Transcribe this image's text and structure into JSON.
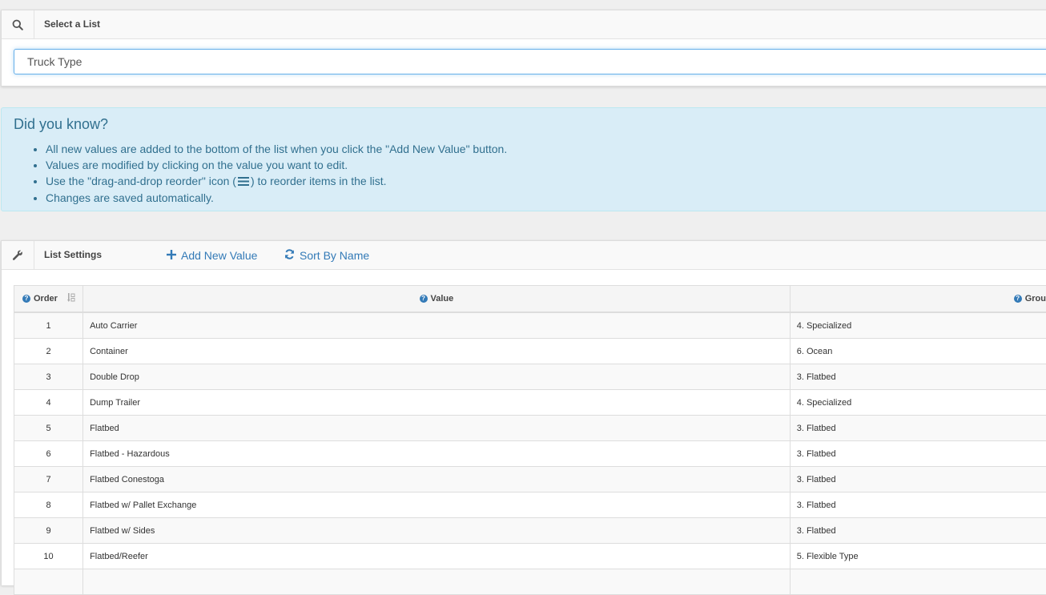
{
  "select_list": {
    "title": "Select a List",
    "icon": "search-icon",
    "selected_value": "Truck Type"
  },
  "info": {
    "title": "Did you know?",
    "tips": [
      "All new values are added to the bottom of the list when you click the \"Add New Value\" button.",
      "Values are modified by clicking on the value you want to edit.",
      "Changes are saved automatically."
    ],
    "reorder_tip_before": "Use the \"drag-and-drop reorder\" icon (",
    "reorder_tip_after": ") to reorder items in the list."
  },
  "list_settings": {
    "title": "List Settings",
    "icon": "wrench-icon",
    "add_label": "Add New Value",
    "sort_label": "Sort By Name"
  },
  "table": {
    "headers": {
      "order": "Order",
      "value": "Value",
      "group": "Grou"
    },
    "rows": [
      {
        "order": "1",
        "value": "Auto Carrier",
        "group": "4. Specialized"
      },
      {
        "order": "2",
        "value": "Container",
        "group": "6. Ocean"
      },
      {
        "order": "3",
        "value": "Double Drop",
        "group": "3. Flatbed"
      },
      {
        "order": "4",
        "value": "Dump Trailer",
        "group": "4. Specialized"
      },
      {
        "order": "5",
        "value": "Flatbed",
        "group": "3. Flatbed"
      },
      {
        "order": "6",
        "value": "Flatbed - Hazardous",
        "group": "3. Flatbed"
      },
      {
        "order": "7",
        "value": "Flatbed Conestoga",
        "group": "3. Flatbed"
      },
      {
        "order": "8",
        "value": "Flatbed w/ Pallet Exchange",
        "group": "3. Flatbed"
      },
      {
        "order": "9",
        "value": "Flatbed w/ Sides",
        "group": "3. Flatbed"
      },
      {
        "order": "10",
        "value": "Flatbed/Reefer",
        "group": "5. Flexible Type"
      },
      {
        "order": "",
        "value": "",
        "group": ""
      }
    ]
  },
  "colors": {
    "accent": "#337ab7",
    "info_bg": "#d9edf7",
    "info_text": "#31708f"
  }
}
